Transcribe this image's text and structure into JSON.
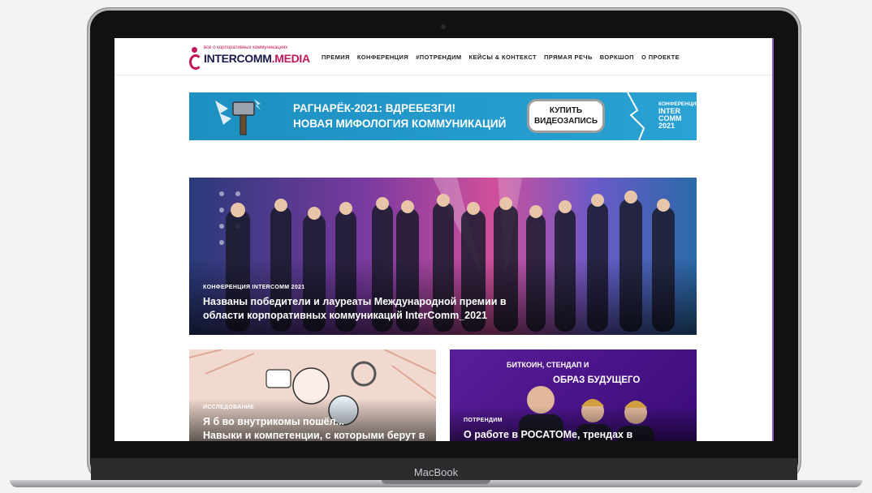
{
  "site": {
    "logo_tag": "все о корпоративных коммуникациях",
    "logo_name_main": "INTERCOMM",
    "logo_name_accent": ".MEDIA"
  },
  "nav": {
    "items": [
      {
        "label": "ПРЕМИЯ"
      },
      {
        "label": "КОНФЕРЕНЦИЯ"
      },
      {
        "label": "#ПОТРЕНДИМ"
      },
      {
        "label": "КЕЙСЫ & КОНТЕКСТ"
      },
      {
        "label": "ПРЯМАЯ РЕЧЬ"
      },
      {
        "label": "ВОРКШОП"
      },
      {
        "label": "О ПРОЕКТЕ"
      }
    ]
  },
  "banner": {
    "line1": "РАГНАРЁК-2021: ВДРЕБЕЗГИ!",
    "line2": "НОВАЯ МИФОЛОГИЯ КОММУНИКАЦИЙ",
    "button_line1": "КУПИТЬ",
    "button_line2": "ВИДЕОЗАПИСЬ",
    "logo_small": "КОНФЕРЕНЦИЯ",
    "logo_line1": "INTER",
    "logo_line2": "COMM",
    "logo_year": "2021"
  },
  "hero": {
    "tag": "КОНФЕРЕНЦИЯ INTERCOMM 2021",
    "title_line1": "Названы победители и лауреаты Международной премии в",
    "title_line2": "области корпоративных коммуникаций InterComm_2021"
  },
  "cards": [
    {
      "tag": "ИССЛЕДОВАНИЕ",
      "title_line1": "Я б во внутрикомы пошёл...",
      "title_line2": "Навыки и компетенции, с которыми берут в"
    },
    {
      "image_text_line1": "БИТКОИН, СТЕНДАП И",
      "image_text_line2": "ОБРАЗ БУДУЩЕГО",
      "tag": "ПОТРЕНДИМ",
      "title_line1": "О работе в РОСАТОМе, трендах в"
    }
  ],
  "device": {
    "brand": "MacBook"
  },
  "colors": {
    "accent": "#c2185b",
    "banner_bg": "#2aa2d4",
    "card_purple": "#4a1488"
  }
}
